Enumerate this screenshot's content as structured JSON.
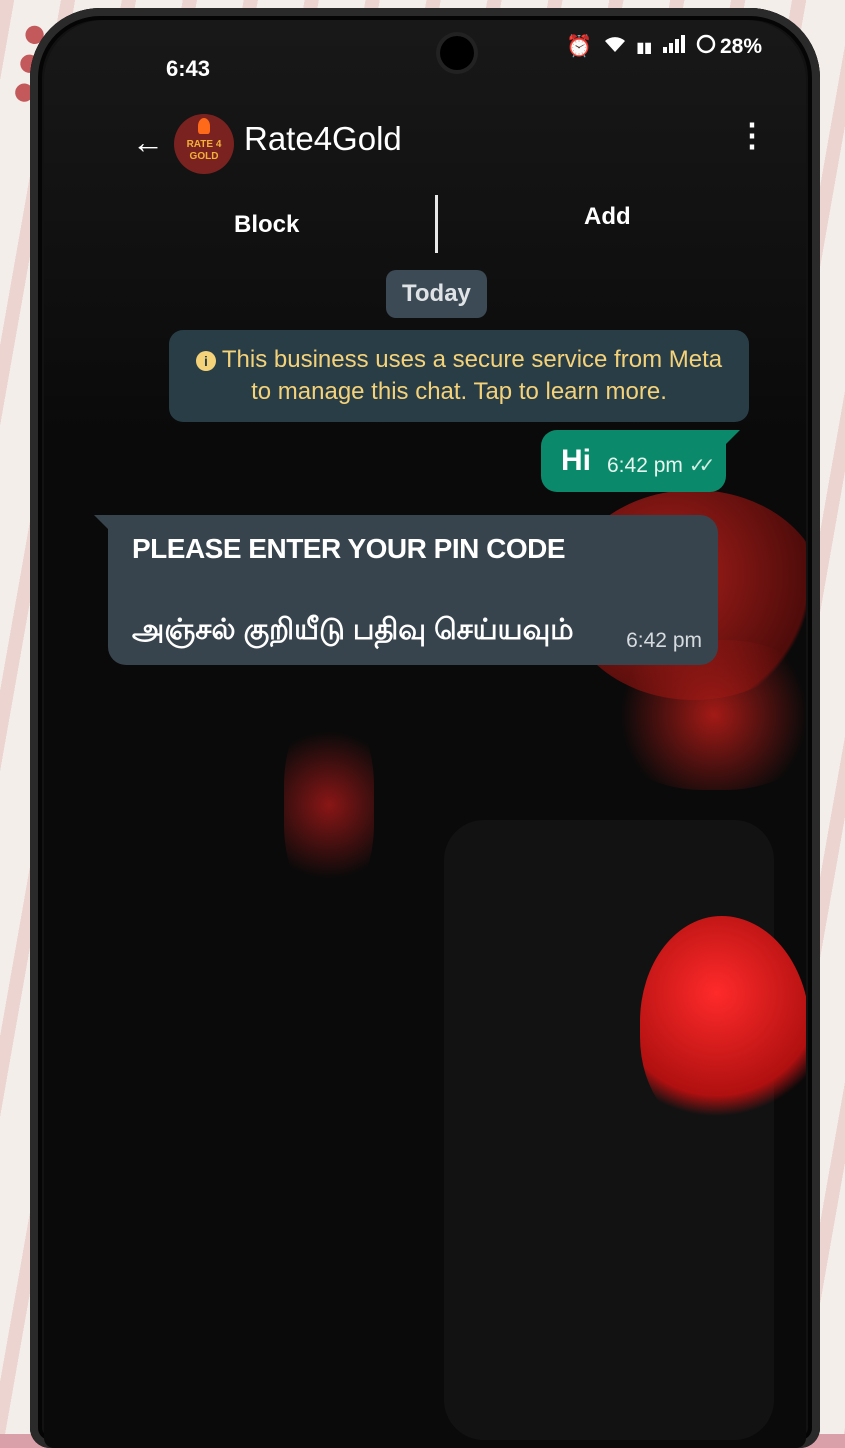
{
  "status_bar": {
    "time": "6:43",
    "battery": "28%",
    "icons": [
      "alarm-icon",
      "wifi-icon",
      "network-icon",
      "signal-icon",
      "battery-icon"
    ]
  },
  "chat_header": {
    "back_icon": "arrow-left-icon",
    "avatar_text": "RATE 4 GOLD",
    "title": "Rate4Gold",
    "menu_icon": "more-vertical-icon"
  },
  "actions": {
    "block_label": "Block",
    "add_label": "Add"
  },
  "date_chip": "Today",
  "system_notice": "This business uses a secure service from Meta to manage this chat. Tap to learn more.",
  "messages": [
    {
      "direction": "outgoing",
      "text": "Hi",
      "time": "6:42 pm",
      "status": "read"
    },
    {
      "direction": "incoming",
      "text_en": "PLEASE ENTER YOUR PIN CODE",
      "text_ta": "அஞ்சல் குறியீடு பதிவு செய்யவும்",
      "time": "6:42 pm"
    }
  ],
  "colors": {
    "outgoing_bubble": "#0a8a6a",
    "incoming_bubble": "#38444d",
    "notice_text": "#f4d27a",
    "chat_background": "#0a0a0a"
  }
}
